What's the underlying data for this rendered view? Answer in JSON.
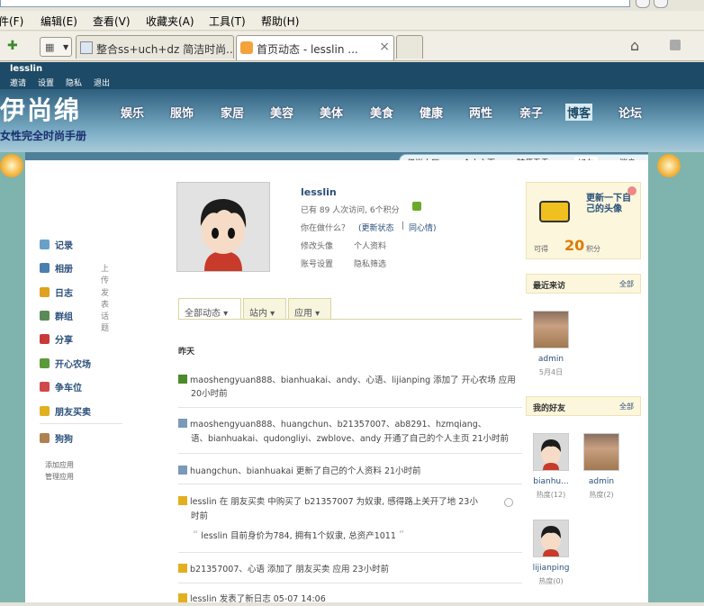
{
  "browser": {
    "menu": [
      "件(F)",
      "编辑(E)",
      "查看(V)",
      "收藏夹(A)",
      "工具(T)",
      "帮助(H)"
    ],
    "tabs": [
      {
        "title": "整合ss+uch+dz 简洁时尚...",
        "active": false
      },
      {
        "title": "首页动态 - lesslin ...",
        "active": true
      }
    ],
    "tab_close": "×"
  },
  "userbar": {
    "username": "lesslin",
    "links": [
      "邀请",
      "设置",
      "隐私",
      "退出"
    ]
  },
  "banner": {
    "logo": "伊尚绵",
    "slogan": "女性完全时尚手册",
    "categories": [
      "娱乐",
      "服饰",
      "家居",
      "美容",
      "美体",
      "美食",
      "健康",
      "两性",
      "亲子",
      "博客",
      "论坛"
    ],
    "active_category": "博客",
    "subnav": [
      "伊尚大厅",
      "个人主页",
      "随便看看",
      "好友",
      "消息"
    ]
  },
  "profile": {
    "name": "lesslin",
    "stats": "已有 89 人次访问, 6个积分",
    "doing_prompt": "你在做什么？",
    "update_status": "(更新状态",
    "pipe": "|",
    "same_mood": "同心情)",
    "actions": [
      [
        "修改头像",
        "个人资料"
      ],
      [
        "账号设置",
        "隐私筛选"
      ]
    ]
  },
  "left_nav": [
    {
      "label": "记录",
      "sub": "",
      "color": "#6aa0c8"
    },
    {
      "label": "相册",
      "sub": "上传",
      "color": "#4a7fb0"
    },
    {
      "label": "日志",
      "sub": "发表",
      "color": "#e0a020"
    },
    {
      "label": "群组",
      "sub": "话题",
      "color": "#5a8a5a"
    },
    {
      "label": "分享",
      "sub": "",
      "color": "#c83a3a"
    },
    {
      "label": "开心农场",
      "sub": "",
      "color": "#5a9a3a"
    },
    {
      "label": "争车位",
      "sub": "",
      "color": "#d04a4a"
    },
    {
      "label": "朋友买卖",
      "sub": "",
      "color": "#e0b020"
    },
    {
      "label": "狗狗",
      "sub": "",
      "color": "#b08050"
    }
  ],
  "app_links": [
    "添加应用",
    "管理应用"
  ],
  "feed_tabs": [
    "全部动态",
    "站内",
    "应用"
  ],
  "feed_day": "昨天",
  "feed": [
    {
      "text": "maoshengyuan888、bianhuakai、andy、心语、lijianping 添加了 开心农场 应用",
      "time": "20小时前",
      "icon": "#4a8a2a"
    },
    {
      "text": "maoshengyuan888、huangchun、b21357007、ab8291、hzmqiang、",
      "text2": "语、bianhuakai、qudongliyi、zwblove、andy 开通了自己的个人主页",
      "time": "21小时前",
      "icon": "#7a9ab8"
    },
    {
      "text": "huangchun、bianhuakai 更新了自己的个人资料",
      "time": "21小时前",
      "icon": "#7a9ab8"
    },
    {
      "text": "lesslin 在 朋友买卖 中购买了 b21357007 为奴隶, 感得路上关开了地",
      "time": "23小",
      "time2": "时前",
      "quote": "lesslin 目前身价为784, 拥有1个奴隶, 总资产1011",
      "icon": "#e0b020"
    },
    {
      "text": "b21357007、心语 添加了 朋友买卖 应用",
      "time": "23小时前",
      "icon": "#e0b020"
    },
    {
      "text": "lesslin 发表了新日志",
      "time": "05-07 14:06",
      "icon": "#e0b020"
    }
  ],
  "right": {
    "avatar_card": {
      "title": "更新一下自己的头像",
      "points_label": "可得",
      "points": "20",
      "points_unit": "积分"
    },
    "recent_visitors": {
      "title": "最近来访",
      "more": "全部",
      "items": [
        {
          "name": "admin",
          "date": "5月4日"
        }
      ]
    },
    "friends": {
      "title": "我的好友",
      "more": "全部",
      "items": [
        {
          "name": "bianhu...",
          "meta": "热度(12)"
        },
        {
          "name": "admin",
          "meta": "热度(2)"
        },
        {
          "name": "lijianping",
          "meta": "热度(0)"
        }
      ]
    }
  }
}
